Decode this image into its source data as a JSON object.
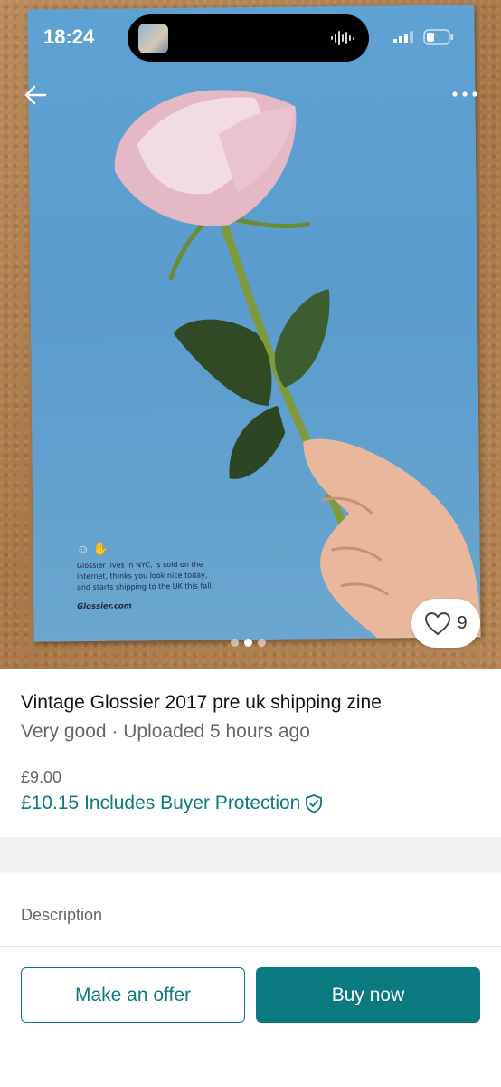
{
  "status_bar": {
    "time": "18:24"
  },
  "photo": {
    "zine_text": {
      "lines": [
        "Glossier lives in NYC, is sold on the",
        "internet, thinks you look nice today,",
        "and starts shipping to the UK this fall."
      ],
      "site": "Glossier.com"
    },
    "carousel": {
      "count": 3,
      "active": 2
    },
    "favorites_count": "9"
  },
  "item": {
    "title": "Vintage Glossier 2017 pre uk shipping zine",
    "subtitle": "Very good · Uploaded 5 hours ago",
    "price": "£9.00",
    "price_total": "£10.15 Includes Buyer Protection"
  },
  "description_label": "Description",
  "actions": {
    "offer_label": "Make an offer",
    "buy_label": "Buy now"
  },
  "colors": {
    "accent": "#0a7a80"
  },
  "icons": [
    "back-arrow-icon",
    "more-icon",
    "heart-icon",
    "shield-check-icon",
    "signal-icon",
    "battery-icon",
    "audio-wave-icon"
  ]
}
